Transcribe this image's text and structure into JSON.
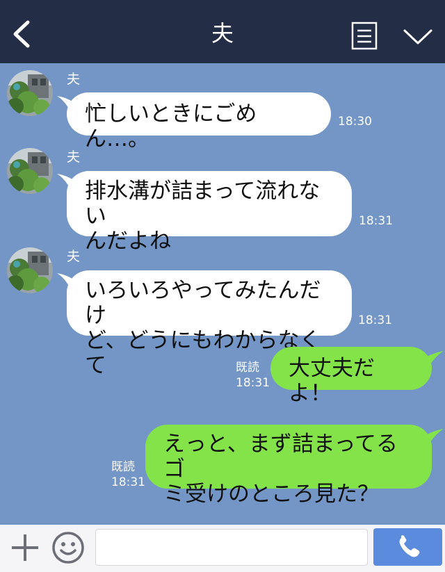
{
  "header": {
    "title": "夫"
  },
  "messages": [
    {
      "sender": "夫",
      "lines": [
        "忙しいときにごめん…。"
      ],
      "time": "18:30"
    },
    {
      "sender": "夫",
      "lines": [
        "排水溝が詰まって流れない",
        "んだよね"
      ],
      "time": "18:31"
    },
    {
      "sender": "夫",
      "lines": [
        "いろいろやってみたんだけ",
        "ど、どうにもわからなくて"
      ],
      "time": "18:31"
    },
    {
      "read": "既読",
      "lines": [
        "大丈夫だよ！"
      ],
      "time": "18:31"
    },
    {
      "read": "既読",
      "lines": [
        "えっと、まず詰まってるゴ",
        "ミ受けのところ見た？"
      ],
      "time": "18:31"
    }
  ],
  "composer": {
    "value": "",
    "placeholder": ""
  },
  "colors": {
    "header": "#232d45",
    "chat_bg": "#7396c6",
    "incoming": "#ffffff",
    "outgoing": "#85e34a",
    "call_button": "#5b8bdd"
  },
  "icons": [
    "back-arrow-icon",
    "menu-list-icon",
    "chevron-down-icon",
    "plus-icon",
    "emoji-icon",
    "phone-icon"
  ]
}
